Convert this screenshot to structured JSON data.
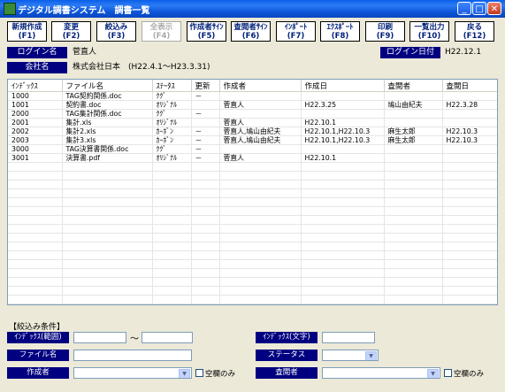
{
  "window": {
    "title": "デジタル調書システム　調書一覧",
    "min_glyph": "_",
    "max_glyph": "□",
    "close_glyph": "✕"
  },
  "fkeys": [
    {
      "l1": "新規作成",
      "l2": "(F1)",
      "enabled": true
    },
    {
      "l1": "変更",
      "l2": "(F2)",
      "enabled": true
    },
    {
      "l1": "絞込み",
      "l2": "(F3)",
      "enabled": true
    },
    {
      "l1": "全表示",
      "l2": "(F4)",
      "enabled": false
    },
    {
      "l1": "作成者ｻｲﾝ",
      "l2": "(F5)",
      "enabled": true
    },
    {
      "l1": "査閲者ｻｲﾝ",
      "l2": "(F6)",
      "enabled": true
    },
    {
      "l1": "ｲﾝﾎﾟｰﾄ",
      "l2": "(F7)",
      "enabled": true
    },
    {
      "l1": "ｴｸｽﾎﾟｰﾄ",
      "l2": "(F8)",
      "enabled": true
    },
    {
      "l1": "印刷",
      "l2": "(F9)",
      "enabled": true
    },
    {
      "l1": "一覧出力",
      "l2": "(F10)",
      "enabled": true
    },
    {
      "l1": "戻る",
      "l2": "(F12)",
      "enabled": true
    }
  ],
  "info": {
    "login_name_label": "ログイン名",
    "login_name_value": "菅直人",
    "login_date_label": "ログイン日付",
    "login_date_value": "H22.12.1",
    "company_label": "会社名",
    "company_value": "株式会社日本　(H22.4.1～H23.3.31)"
  },
  "table": {
    "headers": [
      "ｲﾝﾃﾞｯｸｽ",
      "ファイル名",
      "ｽﾃｰﾀｽ",
      "更新",
      "作成者",
      "作成日",
      "査閲者",
      "査閲日"
    ],
    "rows": [
      [
        "1000",
        "TAG契約関係.doc",
        "ｸｸﾞ",
        "－",
        "",
        "",
        "",
        ""
      ],
      [
        "1001",
        "契約書.doc",
        "ｵﾘｼﾞﾅﾙ",
        "",
        "菅直人",
        "H22.3.25",
        "鳩山由紀夫",
        "H22.3.28"
      ],
      [
        "2000",
        "TAG集計関係.doc",
        "ｸｸﾞ",
        "－",
        "",
        "",
        "",
        ""
      ],
      [
        "2001",
        "集計.xls",
        "ｵﾘｼﾞﾅﾙ",
        "",
        "菅直人",
        "H22.10.1",
        "",
        ""
      ],
      [
        "2002",
        "集計2.xls",
        "ｶｰﾎﾞﾝ",
        "－",
        "菅直人,鳩山由紀夫",
        "H22.10.1,H22.10.3",
        "麻生太郎",
        "H22.10.3"
      ],
      [
        "2003",
        "集計3.xls",
        "ｶｰﾎﾞﾝ",
        "－",
        "菅直人,鳩山由紀夫",
        "H22.10.1,H22.10.3",
        "麻生太郎",
        "H22.10.3"
      ],
      [
        "3000",
        "TAG決算書関係.doc",
        "ｸｸﾞ",
        "－",
        "",
        "",
        "",
        ""
      ],
      [
        "3001",
        "決算書.pdf",
        "ｵﾘｼﾞﾅﾙ",
        "－",
        "菅直人",
        "H22.10.1",
        "",
        ""
      ]
    ]
  },
  "filter": {
    "section_title": "【絞込み条件】",
    "index_range_label": "ｲﾝﾃﾞｯｸｽ(範囲)",
    "index_from": "",
    "tilde": "～",
    "index_to": "",
    "index_text_label": "ｲﾝﾃﾞｯｸｽ(文字)",
    "index_text": "",
    "filename_label": "ファイル名",
    "filename": "",
    "status_label": "ステータス",
    "status_selected": "",
    "creator_label": "作成者",
    "creator_selected": "",
    "creator_blank_only": "空欄のみ",
    "reviewer_label": "査閲者",
    "reviewer_selected": "",
    "reviewer_blank_only": "空欄のみ",
    "dropdown_glyph": "▼"
  }
}
